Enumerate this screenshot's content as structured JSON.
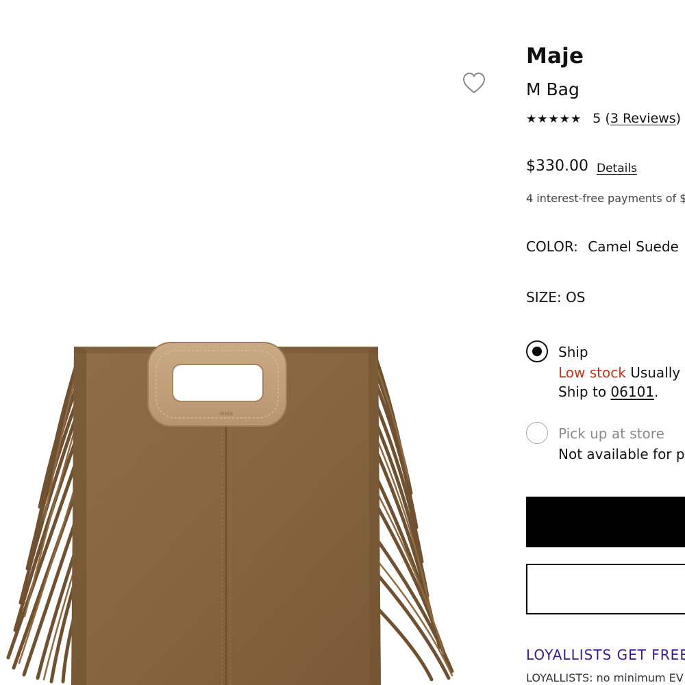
{
  "product": {
    "brand": "Maje",
    "name": "M Bag",
    "rating": {
      "stars": "★★★★★",
      "score": "5",
      "reviews_link": "3 Reviews",
      "value": 5
    },
    "price": "$330.00",
    "details_link": "Details",
    "installments": "4 interest-free payments of $"
  },
  "color": {
    "label": "COLOR:",
    "value": "Camel Suede"
  },
  "size": {
    "label": "SIZE:",
    "value": "OS"
  },
  "fulfillment": {
    "ship": {
      "label": "Ship",
      "selected": true,
      "stock_status": "Low stock",
      "stock_note": "Usually le",
      "ship_to_prefix": "Ship to",
      "zip": "06101",
      "ship_to_suffix": "."
    },
    "pickup": {
      "label": "Pick up at store",
      "selected": false,
      "status": "Not available for pic"
    }
  },
  "loyalty": {
    "heading": "LOYALLISTS GET FREE",
    "subtext": "LOYALLISTS: no minimum EV"
  },
  "icons": {
    "wishlist": "heart-outline-icon",
    "rating": "star-icon"
  },
  "colors": {
    "low_stock": "#c1371d",
    "loyalty": "#3d1a8c",
    "primary_button": "#000000",
    "bag_suede": "#8a6a45"
  }
}
